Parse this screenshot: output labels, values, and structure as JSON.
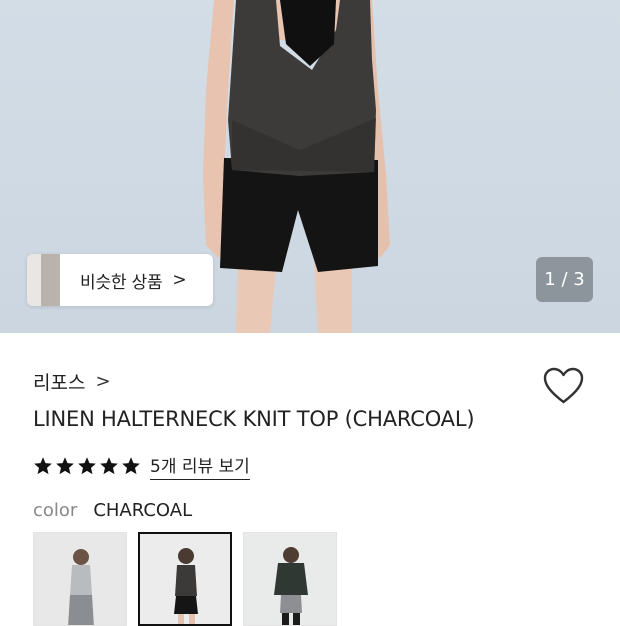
{
  "hero": {
    "similar_button_label": "비슷한 상품",
    "similar_button_chevron": ">",
    "image_counter": "1 / 3"
  },
  "product": {
    "brand": "리포스",
    "brand_chevron": ">",
    "title": "LINEN HALTERNECK KNIT TOP (CHARCOAL)",
    "rating_stars": 5,
    "review_link": "5개 리뷰 보기"
  },
  "options": {
    "color_label": "color",
    "color_value": "CHARCOAL",
    "swatches": [
      {
        "name": "gray",
        "selected": false
      },
      {
        "name": "charcoal",
        "selected": true
      },
      {
        "name": "green",
        "selected": false
      }
    ]
  },
  "colors": {
    "background": "#ffffff",
    "hero_background": "#d0dae4",
    "text": "#222222",
    "muted": "#888888",
    "counter_bg": "#5a5f64"
  }
}
